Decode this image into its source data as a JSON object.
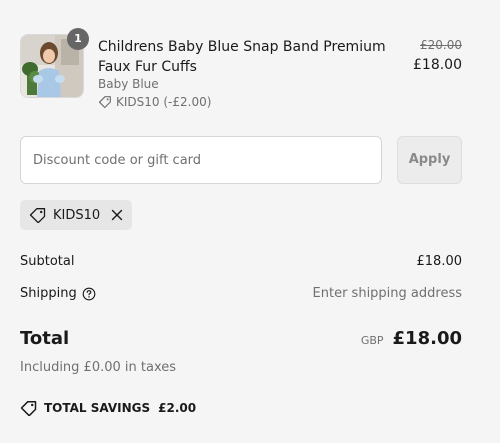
{
  "product": {
    "quantity": "1",
    "name": "Childrens Baby Blue Snap Band Premium Faux Fur Cuffs",
    "variant": "Baby Blue",
    "discount_label": "KIDS10 (-£2.00)",
    "original_price": "£20.00",
    "price": "£18.00",
    "thumbnail_icon": "product-photo"
  },
  "discount": {
    "placeholder": "Discount code or gift card",
    "value": "",
    "apply_label": "Apply",
    "applied_code": "KIDS10"
  },
  "summary": {
    "subtotal_label": "Subtotal",
    "subtotal_value": "£18.00",
    "shipping_label": "Shipping",
    "shipping_value": "Enter shipping address",
    "total_label": "Total",
    "currency": "GBP",
    "total_value": "£18.00",
    "taxes_note": "Including £0.00 in taxes",
    "savings_label": "TOTAL SAVINGS",
    "savings_value": "£2.00"
  },
  "colors": {
    "background": "#f5f5f5",
    "text": "#1a1a1a",
    "muted_text": "#707070",
    "badge": "#666666",
    "chip": "#e6e6e6"
  }
}
